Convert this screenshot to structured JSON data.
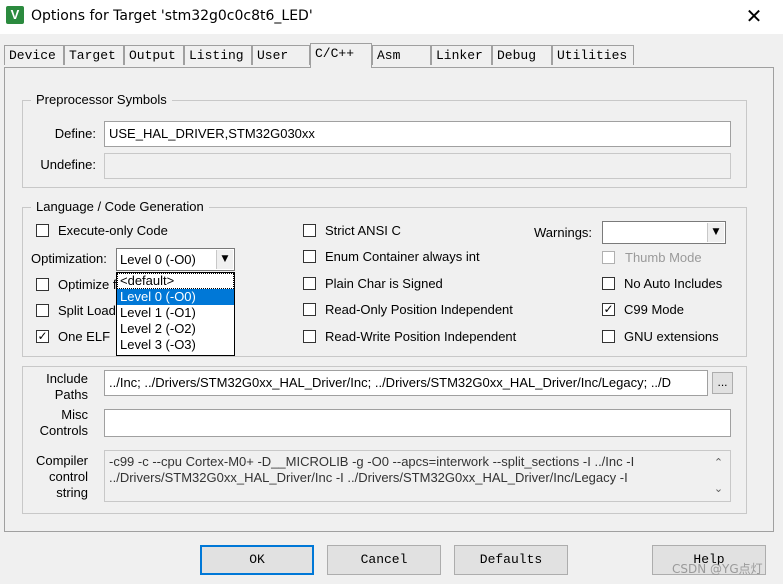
{
  "window": {
    "title": "Options for Target 'stm32g0c0c8t6_LED'",
    "close_glyph": "✕",
    "app_icon_glyph": "V"
  },
  "tabs": [
    {
      "label": "Device"
    },
    {
      "label": "Target"
    },
    {
      "label": "Output"
    },
    {
      "label": "Listing"
    },
    {
      "label": "User"
    },
    {
      "label": "C/C++",
      "active": true
    },
    {
      "label": "Asm"
    },
    {
      "label": "Linker"
    },
    {
      "label": "Debug"
    },
    {
      "label": "Utilities"
    }
  ],
  "preprocessor": {
    "group_title": "Preprocessor Symbols",
    "define_label": "Define:",
    "define_value": "USE_HAL_DRIVER,STM32G030xx",
    "undefine_label": "Undefine:",
    "undefine_value": ""
  },
  "language": {
    "group_title": "Language / Code Generation",
    "execute_only": {
      "label": "Execute-only Code",
      "checked": false
    },
    "optimization_label": "Optimization:",
    "optimization_value": "Level 0 (-O0)",
    "optimization_options": [
      "<default>",
      "Level 0 (-O0)",
      "Level 1 (-O1)",
      "Level 2 (-O2)",
      "Level 3 (-O3)"
    ],
    "optimization_selected_index": 1,
    "optimize_for_time": {
      "label": "Optimize f",
      "checked": false
    },
    "split_load": {
      "label": "Split Load",
      "checked": false
    },
    "one_elf": {
      "label": "One ELF",
      "checked": true
    },
    "strict_ansi": {
      "label": "Strict ANSI C",
      "checked": false
    },
    "enum_container": {
      "label": "Enum Container always int",
      "checked": false
    },
    "plain_char": {
      "label": "Plain Char is Signed",
      "checked": false
    },
    "ro_pi": {
      "label": "Read-Only Position Independent",
      "checked": false
    },
    "rw_pi": {
      "label": "Read-Write Position Independent",
      "checked": false
    },
    "warnings_label": "Warnings:",
    "warnings_value": "",
    "thumb_mode": {
      "label": "Thumb Mode",
      "checked": false
    },
    "no_auto_includes": {
      "label": "No Auto Includes",
      "checked": false
    },
    "c99_mode": {
      "label": "C99 Mode",
      "checked": true
    },
    "gnu_extensions": {
      "label": "GNU extensions",
      "checked": false
    },
    "check_glyph": "✓"
  },
  "include_paths": {
    "label_line1": "Include",
    "label_line2": "Paths",
    "value": "../Inc; ../Drivers/STM32G0xx_HAL_Driver/Inc; ../Drivers/STM32G0xx_HAL_Driver/Inc/Legacy; ../D",
    "browse_label": "..."
  },
  "misc_controls": {
    "label_line1": "Misc",
    "label_line2": "Controls",
    "value": ""
  },
  "compiler_control": {
    "label_line1": "Compiler",
    "label_line2": "control",
    "label_line3": "string",
    "line1": "-c99 -c --cpu Cortex-M0+ -D__MICROLIB -g -O0 --apcs=interwork --split_sections -I ../Inc -I",
    "line2": "../Drivers/STM32G0xx_HAL_Driver/Inc -I ../Drivers/STM32G0xx_HAL_Driver/Inc/Legacy -I",
    "scroll_up": "⌃",
    "scroll_down": "⌄"
  },
  "buttons": {
    "ok": "OK",
    "cancel": "Cancel",
    "defaults": "Defaults",
    "help": "Help"
  },
  "watermark": "CSDN @YG点灯"
}
